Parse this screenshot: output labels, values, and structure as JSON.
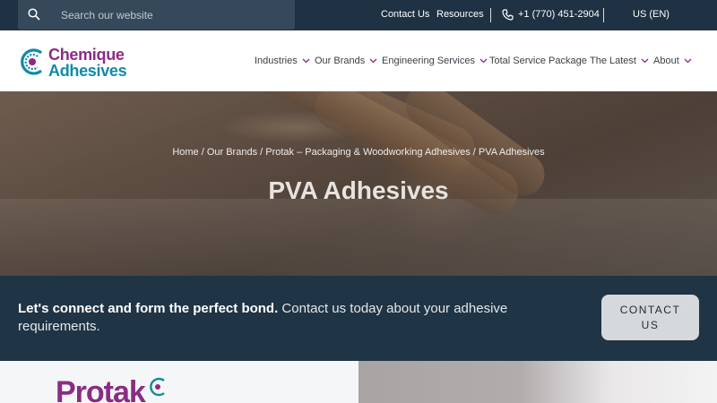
{
  "topbar": {
    "search_placeholder": "Search our website",
    "links": [
      "Contact Us",
      "Resources"
    ],
    "phone": "+1 (770) 451-2904",
    "locale": "US (EN)"
  },
  "header": {
    "logo_line1": "Chemique",
    "logo_line2": "Adhesives",
    "nav": [
      {
        "label": "Industries",
        "dropdown": true
      },
      {
        "label": "Our Brands",
        "dropdown": true
      },
      {
        "label": "Engineering Services",
        "dropdown": true
      },
      {
        "label": "Total Service Package",
        "dropdown": false
      },
      {
        "label": "The Latest",
        "dropdown": true
      },
      {
        "label": "About",
        "dropdown": true
      }
    ]
  },
  "hero": {
    "breadcrumb": "Home / Our Brands / Protak – Packaging & Woodworking Adhesives / PVA Adhesives",
    "title": "PVA Adhesives"
  },
  "cta": {
    "bold": "Let's connect and form the perfect bond.",
    "text": " Contact us today about your adhesive requirements.",
    "button_line1": "CONTACT",
    "button_line2": "US"
  },
  "brand": {
    "name": "Protak"
  },
  "colors": {
    "navy": "#1e3243",
    "purple": "#8a2c84",
    "teal": "#0f8ba8"
  }
}
